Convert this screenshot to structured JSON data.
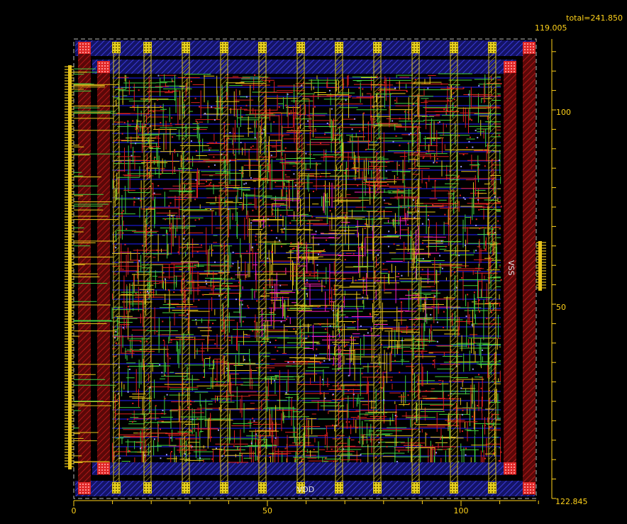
{
  "header": {
    "total_label": "total=241.850",
    "top_right_coord": "119.005",
    "bottom_right_coord": "122.845"
  },
  "x_axis": {
    "ticks": [
      "0",
      "50",
      "100"
    ],
    "tick_values": [
      0,
      50,
      100
    ]
  },
  "y_axis": {
    "ticks": [
      "100",
      "50"
    ],
    "tick_values": [
      100,
      50
    ]
  },
  "nets": {
    "power": "VDD",
    "ground": "VSS"
  },
  "colors": {
    "background": "#000000",
    "axis": "#ffd21a",
    "rail_fill": "#1a1a7a",
    "rail_hatch": "#3a3ad8",
    "strap": "#d8c020",
    "ring": "#7a1010",
    "ring_hatch": "#c02020",
    "wire_yellow": "#e8c41a",
    "wire_green": "#40d040",
    "wire_red": "#e02020",
    "wire_magenta": "#ff20c0",
    "wire_blue": "#2020ff"
  }
}
